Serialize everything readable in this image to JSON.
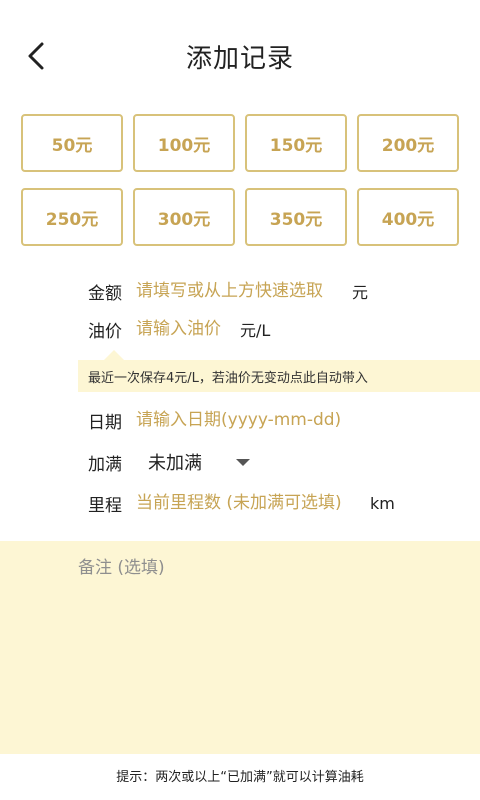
{
  "header": {
    "title": "添加记录",
    "back_icon": "chevron-left-icon"
  },
  "amount_options": [
    "50元",
    "100元",
    "150元",
    "200元",
    "250元",
    "300元",
    "350元",
    "400元"
  ],
  "form": {
    "amount": {
      "label": "金额",
      "placeholder": "请填写或从上方快速选取",
      "unit": "元"
    },
    "price": {
      "label": "油价",
      "placeholder": "请输入油价",
      "unit": "元/L"
    },
    "tip": "最近一次保存4元/L，若油价无变动点此自动带入",
    "date": {
      "label": "日期",
      "placeholder": "请输入日期(yyyy-mm-dd)"
    },
    "full": {
      "label": "加满",
      "value": "未加满"
    },
    "mileage": {
      "label": "里程",
      "placeholder": "当前里程数 (未加满可选填)",
      "unit": "km"
    }
  },
  "notes": {
    "placeholder": "备注 (选填)"
  },
  "hint": "提示：两次或以上“已加满”就可以计算油耗",
  "colors": {
    "accent": "#c7a454",
    "accent_border": "#d8c27a",
    "tip_bg": "#fdf6d4"
  }
}
